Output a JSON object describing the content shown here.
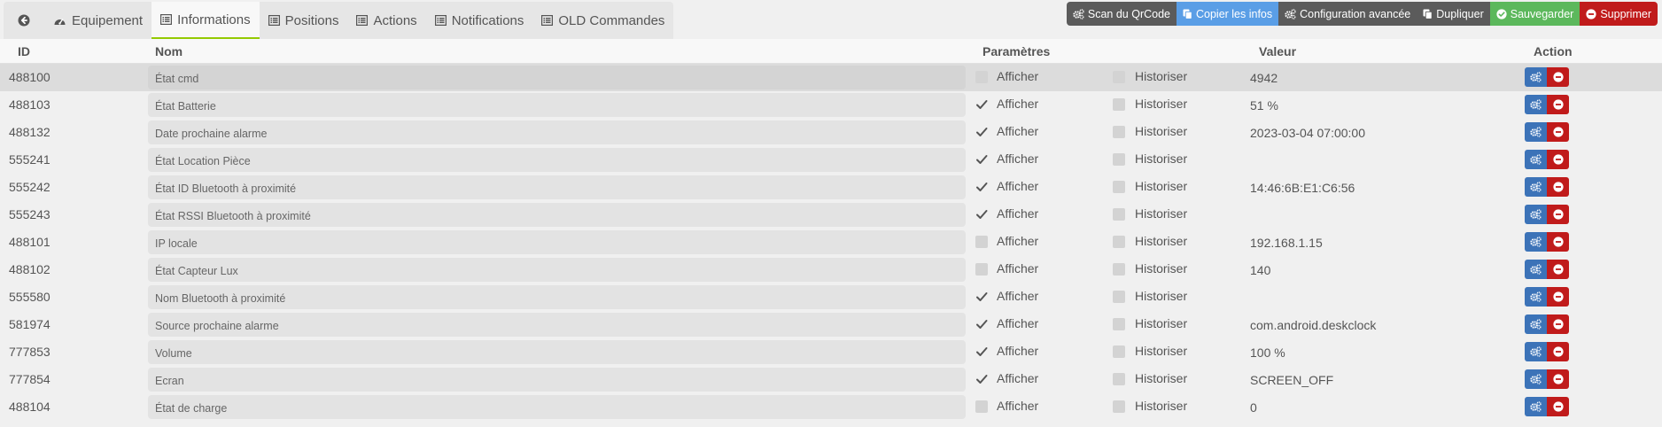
{
  "tabs": [
    {
      "label": "",
      "icon": "arrow-circle-left-icon",
      "active": false
    },
    {
      "label": "Equipement",
      "icon": "dashboard-icon",
      "active": false
    },
    {
      "label": "Informations",
      "icon": "list-icon",
      "active": true
    },
    {
      "label": "Positions",
      "icon": "list-icon",
      "active": false
    },
    {
      "label": "Actions",
      "icon": "list-icon",
      "active": false
    },
    {
      "label": "Notifications",
      "icon": "list-icon",
      "active": false
    },
    {
      "label": "OLD Commandes",
      "icon": "list-icon",
      "active": false
    }
  ],
  "actions": [
    {
      "label": "Scan du QrCode",
      "icon": "cogs-icon",
      "color": "#5b5b5b"
    },
    {
      "label": "Copier les infos",
      "icon": "copy-icon",
      "color": "#5a9ee6"
    },
    {
      "label": "Configuration avancée",
      "icon": "cogs-icon",
      "color": "#5b5b5b"
    },
    {
      "label": "Dupliquer",
      "icon": "copy-icon",
      "color": "#5b5b5b"
    },
    {
      "label": "Sauvegarder",
      "icon": "check-circle-icon",
      "color": "#5cb85c"
    },
    {
      "label": "Supprimer",
      "icon": "minus-circle-icon",
      "color": "#c01b1b"
    }
  ],
  "table": {
    "headers": {
      "id": "ID",
      "name": "Nom",
      "params": "Paramètres",
      "value": "Valeur",
      "action": "Action"
    },
    "afficher_label": "Afficher",
    "historiser_label": "Historiser",
    "rows": [
      {
        "id": "488100",
        "name": "État cmd",
        "afficher": false,
        "historiser": false,
        "value": "4942",
        "highlight": true
      },
      {
        "id": "488103",
        "name": "État Batterie",
        "afficher": true,
        "historiser": false,
        "value": "51 %"
      },
      {
        "id": "488132",
        "name": "Date prochaine alarme",
        "afficher": true,
        "historiser": false,
        "value": "2023-03-04 07:00:00"
      },
      {
        "id": "555241",
        "name": "État Location Pièce",
        "afficher": true,
        "historiser": false,
        "value": ""
      },
      {
        "id": "555242",
        "name": "État ID Bluetooth à proximité",
        "afficher": true,
        "historiser": false,
        "value": "14:46:6B:E1:C6:56"
      },
      {
        "id": "555243",
        "name": "État RSSI Bluetooth à proximité",
        "afficher": true,
        "historiser": false,
        "value": ""
      },
      {
        "id": "488101",
        "name": "IP locale",
        "afficher": false,
        "historiser": false,
        "value": "192.168.1.15"
      },
      {
        "id": "488102",
        "name": "État Capteur Lux",
        "afficher": false,
        "historiser": false,
        "value": "140"
      },
      {
        "id": "555580",
        "name": "Nom Bluetooth à proximité",
        "afficher": true,
        "historiser": false,
        "value": ""
      },
      {
        "id": "581974",
        "name": "Source prochaine alarme",
        "afficher": true,
        "historiser": false,
        "value": "com.android.deskclock"
      },
      {
        "id": "777853",
        "name": "Volume",
        "afficher": true,
        "historiser": false,
        "value": "100 %"
      },
      {
        "id": "777854",
        "name": "Ecran",
        "afficher": true,
        "historiser": false,
        "value": "SCREEN_OFF"
      },
      {
        "id": "488104",
        "name": "État de charge",
        "afficher": false,
        "historiser": false,
        "value": "0"
      }
    ]
  }
}
